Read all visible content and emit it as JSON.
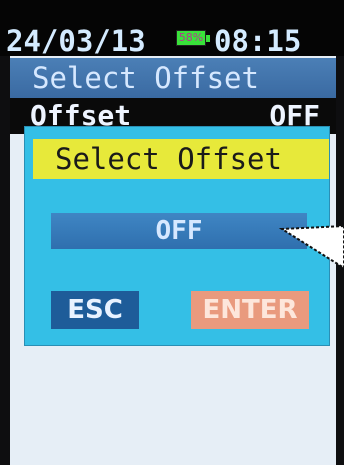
{
  "status_bar": {
    "date": "24/03/13",
    "battery_percent": "58%",
    "time": "08:15"
  },
  "menu": {
    "title": "Select Offset"
  },
  "offset_row": {
    "label": "Offset",
    "value": "OFF"
  },
  "dialog": {
    "title": "Select Offset",
    "selected_value": "OFF",
    "esc_label": "ESC",
    "enter_label": "ENTER"
  },
  "colors": {
    "dialog_bg": "#34bfe6",
    "title_highlight": "#e7e93a",
    "battery": "#39e23a",
    "esc_button": "#1e5c99",
    "enter_button": "#e99a7e"
  }
}
